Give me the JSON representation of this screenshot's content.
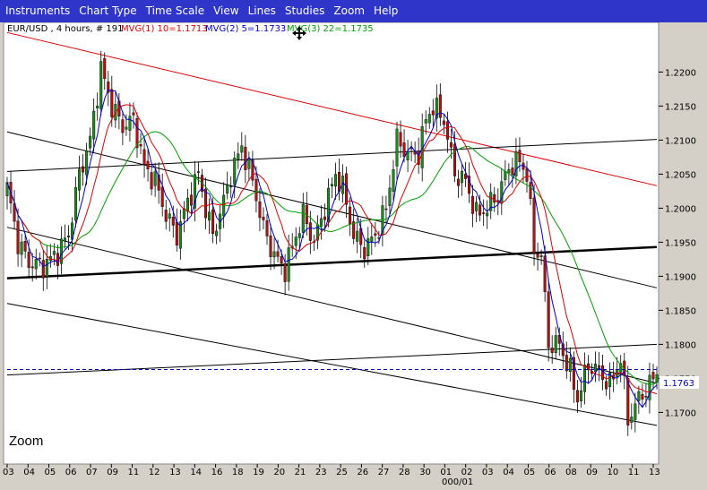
{
  "menu": [
    "Instruments",
    "Chart Type",
    "Time Scale",
    "View",
    "Lines",
    "Studies",
    "Zoom",
    "Help"
  ],
  "legend": {
    "instrument": "EUR/USD , 4 hours, # 191",
    "mvg1": "MVG(1) 10=1.1713",
    "mvg2": "MVG(2) 5=1.1733",
    "mvg3": "MVG(3) 22=1.1735",
    "mvg1_color": "#e00000",
    "mvg2_color": "#0000d0",
    "mvg3_color": "#00a000"
  },
  "zoom_label": "Zoom",
  "last_price_label": "1.1763",
  "date_footer": "000/01",
  "colors": {
    "up": "#1a8a1a",
    "down": "#b01010",
    "channel": "#e00000",
    "ma10": "#e00000",
    "ma5": "#0000d0",
    "ma22": "#00a000",
    "last_price": "#0000c0"
  },
  "chart_data": {
    "type": "candlestick",
    "title": "EUR/USD , 4 hours, # 191",
    "ylim": [
      1.164,
      1.224
    ],
    "y_ticks": [
      "1.2200",
      "1.2150",
      "1.2100",
      "1.2050",
      "1.2000",
      "1.1950",
      "1.1900",
      "1.1850",
      "1.1800",
      "1.1750",
      "1.1700"
    ],
    "x_ticks": [
      "03",
      "04",
      "05",
      "06",
      "07",
      "09",
      "11",
      "12",
      "13",
      "14",
      "16",
      "18",
      "19",
      "20",
      "21",
      "23",
      "25",
      "26",
      "27",
      "28",
      "30",
      "01",
      "02",
      "03",
      "04",
      "05",
      "06",
      "08",
      "09",
      "10",
      "11",
      "13"
    ],
    "last_price": 1.1763,
    "series": [
      {
        "name": "MVG(1) 10",
        "last": 1.1713
      },
      {
        "name": "MVG(2) 5",
        "last": 1.1733
      },
      {
        "name": "MVG(3) 22",
        "last": 1.1735
      }
    ],
    "close_path": [
      [
        0,
        1.203
      ],
      [
        3,
        1.195
      ],
      [
        6,
        1.192
      ],
      [
        10,
        1.1915
      ],
      [
        14,
        1.1935
      ],
      [
        17,
        1.196
      ],
      [
        20,
        1.205
      ],
      [
        23,
        1.21
      ],
      [
        26,
        1.2205
      ],
      [
        29,
        1.215
      ],
      [
        32,
        1.212
      ],
      [
        35,
        1.213
      ],
      [
        38,
        1.206
      ],
      [
        41,
        1.204
      ],
      [
        44,
        1.199
      ],
      [
        47,
        1.196
      ],
      [
        50,
        1.201
      ],
      [
        53,
        1.205
      ],
      [
        55,
        1.2
      ],
      [
        57,
        1.196
      ],
      [
        60,
        1.201
      ],
      [
        62,
        1.205
      ],
      [
        65,
        1.209
      ],
      [
        68,
        1.204
      ],
      [
        71,
        1.197
      ],
      [
        74,
        1.193
      ],
      [
        77,
        1.191
      ],
      [
        80,
        1.196
      ],
      [
        82,
        1.199
      ],
      [
        85,
        1.195
      ],
      [
        88,
        1.2
      ],
      [
        91,
        1.205
      ],
      [
        93,
        1.203
      ],
      [
        96,
        1.196
      ],
      [
        99,
        1.194
      ],
      [
        102,
        1.196
      ],
      [
        105,
        1.2
      ],
      [
        108,
        1.21
      ],
      [
        111,
        1.208
      ],
      [
        114,
        1.208
      ],
      [
        116,
        1.213
      ],
      [
        118,
        1.215
      ],
      [
        121,
        1.213
      ],
      [
        124,
        1.205
      ],
      [
        127,
        1.204
      ],
      [
        130,
        1.199
      ],
      [
        133,
        1.2
      ],
      [
        136,
        1.202
      ],
      [
        139,
        1.206
      ],
      [
        142,
        1.207
      ],
      [
        144,
        1.205
      ],
      [
        146,
        1.194
      ],
      [
        148,
        1.193
      ],
      [
        150,
        1.18
      ],
      [
        153,
        1.18
      ],
      [
        156,
        1.176
      ],
      [
        158,
        1.172
      ],
      [
        161,
        1.177
      ],
      [
        164,
        1.176
      ],
      [
        167,
        1.174
      ],
      [
        170,
        1.178
      ],
      [
        172,
        1.169
      ],
      [
        175,
        1.172
      ],
      [
        178,
        1.174
      ],
      [
        180,
        1.176
      ]
    ],
    "channel_lines": [
      {
        "color": "red",
        "from": [
          1.2258,
          0
        ],
        "to": [
          1.2033,
          180
        ]
      },
      {
        "color": "black",
        "from": [
          1.2054,
          0
        ],
        "to": [
          1.2101,
          180
        ]
      },
      {
        "color": "black",
        "from": [
          1.2112,
          0
        ],
        "to": [
          1.1883,
          180
        ]
      },
      {
        "color": "black",
        "from": [
          1.1972,
          0
        ],
        "to": [
          1.1743,
          180
        ]
      },
      {
        "color": "black",
        "from": [
          1.186,
          0
        ],
        "to": [
          1.1681,
          180
        ]
      },
      {
        "color": "black",
        "from": [
          1.1755,
          0
        ],
        "to": [
          1.18,
          180
        ]
      },
      {
        "color": "black_bold",
        "from": [
          1.1897,
          0
        ],
        "to": [
          1.1943,
          180
        ]
      }
    ]
  }
}
